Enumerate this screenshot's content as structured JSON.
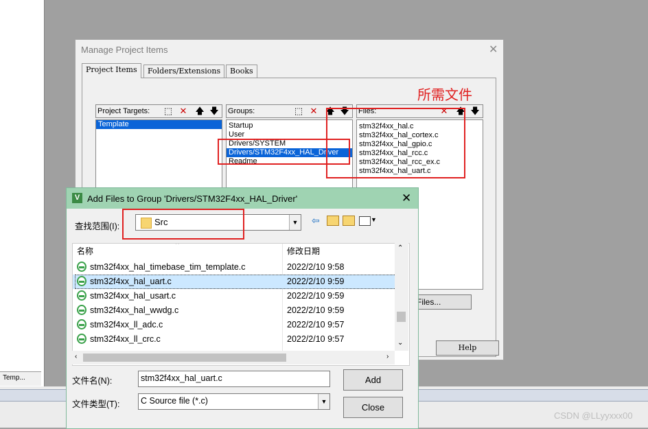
{
  "ide": {
    "tab_label": "Temp..."
  },
  "manage_dialog": {
    "title": "Manage Project Items",
    "close": "✕",
    "tabs": [
      "Project Items",
      "Folders/Extensions",
      "Books"
    ],
    "targets_label": "Project Targets:",
    "targets": [
      "Template"
    ],
    "groups_label": "Groups:",
    "groups": [
      "Startup",
      "User",
      "Drivers/SYSTEM",
      "Drivers/STM32F4xx_HAL_Driver",
      "Readme"
    ],
    "selected_group": "Drivers/STM32F4xx_HAL_Driver",
    "files_label": "Files:",
    "files": [
      "stm32f4xx_hal.c",
      "stm32f4xx_hal_cortex.c",
      "stm32f4xx_hal_gpio.c",
      "stm32f4xx_hal_rcc.c",
      "stm32f4xx_hal_rcc_ex.c",
      "stm32f4xx_hal_uart.c"
    ],
    "add_files_button": "Files...",
    "help_button": "Help",
    "annotation": "所需文件"
  },
  "add_dialog": {
    "title": "Add Files to Group 'Drivers/STM32F4xx_HAL_Driver'",
    "close": "✕",
    "look_in_label": "查找范围(I):",
    "look_in_value": "Src",
    "columns": {
      "name": "名称",
      "date": "修改日期"
    },
    "files": [
      {
        "name": "stm32f4xx_hal_timebase_tim_template.c",
        "date": "2022/2/10 9:58"
      },
      {
        "name": "stm32f4xx_hal_uart.c",
        "date": "2022/2/10 9:59"
      },
      {
        "name": "stm32f4xx_hal_usart.c",
        "date": "2022/2/10 9:59"
      },
      {
        "name": "stm32f4xx_hal_wwdg.c",
        "date": "2022/2/10 9:59"
      },
      {
        "name": "stm32f4xx_ll_adc.c",
        "date": "2022/2/10 9:57"
      },
      {
        "name": "stm32f4xx_ll_crc.c",
        "date": "2022/2/10 9:57"
      }
    ],
    "selected_file": "stm32f4xx_hal_uart.c",
    "filename_label": "文件名(N):",
    "filename_value": "stm32f4xx_hal_uart.c",
    "filetype_label": "文件类型(T):",
    "filetype_value": "C Source file (*.c)",
    "add_button": "Add",
    "close_button": "Close"
  },
  "watermark": "CSDN @LLyyxxx00",
  "colors": {
    "annotation_red": "#e02020",
    "selection_blue": "#0a64d8",
    "dialog_title_green": "#9fd3b2"
  }
}
